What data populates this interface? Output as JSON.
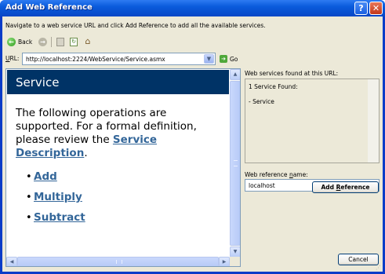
{
  "window": {
    "title": "Add Web Reference",
    "help_glyph": "?",
    "close_glyph": "✕"
  },
  "intro_text": "Navigate to a web service URL and click Add Reference to add all the available services.",
  "toolbar": {
    "back_label": "Back",
    "back_icon": "back-arrow-icon",
    "forward_icon": "forward-arrow-icon",
    "stop_icon": "stop-icon",
    "refresh_icon": "refresh-icon",
    "home_icon": "home-icon"
  },
  "url_bar": {
    "label_prefix": "",
    "label_access": "U",
    "label_rest": "RL:",
    "value": "http://localhost:2224/WebService/Service.asmx",
    "go_label": "Go"
  },
  "service_page": {
    "header": "Service",
    "intro_text": "The following operations are supported. For a formal definition, please review the ",
    "intro_link": "Service Description",
    "intro_end": ".",
    "operations": [
      "Add",
      "Multiply",
      "Subtract"
    ],
    "header_color": "#003366",
    "link_color": "#336699"
  },
  "found_panel": {
    "label": "Web services found at this URL:",
    "count_text": "1 Service Found:",
    "items": [
      "- Service"
    ]
  },
  "reference_name": {
    "label_prefix": "Web reference ",
    "label_access": "n",
    "label_rest": "ame:",
    "value": "localhost"
  },
  "buttons": {
    "add_reference_prefix": "Add ",
    "add_reference_access": "R",
    "add_reference_rest": "eference",
    "cancel": "Cancel"
  }
}
